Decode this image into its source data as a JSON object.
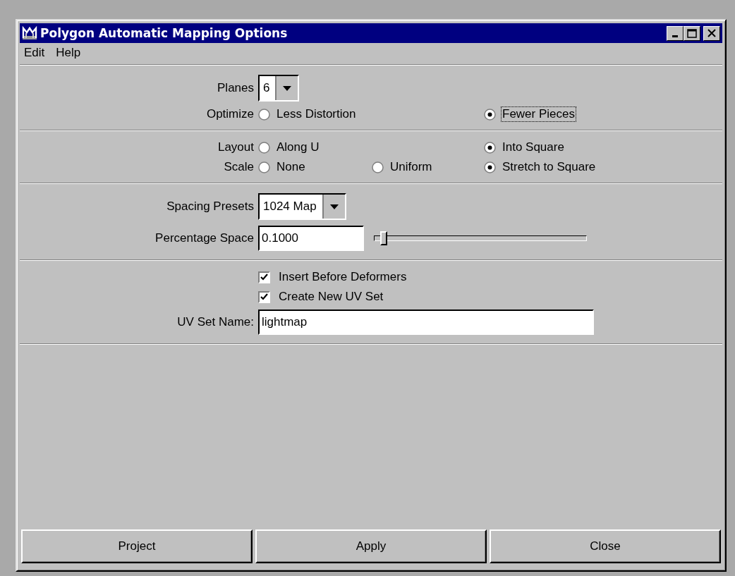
{
  "window": {
    "title": "Polygon Automatic Mapping Options"
  },
  "menu": [
    "Edit",
    "Help"
  ],
  "sections": [
    {
      "rows": [
        {
          "kind": "dropdown",
          "label": "Planes",
          "value": "6"
        },
        {
          "kind": "radio",
          "label": "Optimize",
          "options": [
            {
              "label": "Less Distortion",
              "selected": false,
              "focused": false
            },
            {
              "label": "Fewer Pieces",
              "selected": true,
              "focused": true
            }
          ]
        }
      ]
    },
    {
      "rows": [
        {
          "kind": "radio",
          "label": "Layout",
          "options": [
            {
              "label": "Along U",
              "selected": false,
              "focused": false
            },
            {
              "label": "Into Square",
              "selected": true,
              "focused": false
            }
          ]
        },
        {
          "kind": "radio",
          "label": "Scale",
          "options": [
            {
              "label": "None",
              "selected": false,
              "focused": false
            },
            {
              "label": "Uniform",
              "selected": false,
              "focused": false
            },
            {
              "label": "Stretch to Square",
              "selected": true,
              "focused": false
            }
          ]
        }
      ]
    },
    {
      "rows": [
        {
          "kind": "dropdown",
          "label": "Spacing Presets",
          "value": "1024 Map"
        },
        {
          "kind": "slider",
          "label": "Percentage Space",
          "value": "0.1000",
          "level": 0.03
        }
      ]
    },
    {
      "rows": [
        {
          "kind": "checkbox",
          "label": "Insert Before Deformers",
          "checked": true
        },
        {
          "kind": "checkbox",
          "label": "Create New UV Set",
          "checked": true
        },
        {
          "kind": "text",
          "label": "UV Set Name:",
          "value": "lightmap"
        }
      ]
    }
  ],
  "buttons": [
    "Project",
    "Apply",
    "Close"
  ]
}
